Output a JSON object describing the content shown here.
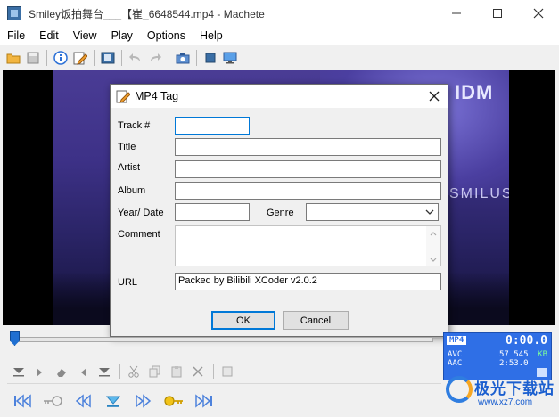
{
  "window": {
    "title": "Smiley饭拍舞台___【崔_6648544.mp4 - Machete",
    "minimize_icon": "minimize-icon",
    "maximize_icon": "maximize-icon",
    "close_icon": "close-icon"
  },
  "menu": [
    "File",
    "Edit",
    "View",
    "Play",
    "Options",
    "Help"
  ],
  "toolbar": {
    "icons": [
      "open-folder-icon",
      "save-icon",
      "info-icon",
      "edit-tag-icon",
      "film-icon",
      "undo-icon",
      "redo-icon",
      "snapshot-icon",
      "crop-icon",
      "monitor-icon"
    ]
  },
  "video": {
    "logo_text": "IDM",
    "banner_text": "SMILUS"
  },
  "dialog": {
    "title": "MP4 Tag",
    "fields": {
      "track_label": "Track #",
      "title_label": "Title",
      "artist_label": "Artist",
      "album_label": "Album",
      "year_label": "Year/ Date",
      "genre_label": "Genre",
      "comment_label": "Comment",
      "url_label": "URL",
      "track_value": "",
      "title_value": "",
      "artist_value": "",
      "album_value": "",
      "year_value": "",
      "genre_value": "",
      "comment_value": "",
      "url_value": "Packed by Bilibili XCoder v2.0.2"
    },
    "ok_label": "OK",
    "cancel_label": "Cancel"
  },
  "seek": {
    "position_fraction": 0.0
  },
  "info_panel": {
    "format": "MP4",
    "time": "0:00.0",
    "video_codec": "AVC",
    "audio_codec": "AAC",
    "size": "57 545",
    "size_unit": "KB",
    "duration": "2:53.0"
  },
  "watermark": {
    "brand": "极光下载站",
    "url": "www.xz7.com"
  },
  "colors": {
    "accent": "#2f6fe6",
    "focus": "#0078d7"
  }
}
